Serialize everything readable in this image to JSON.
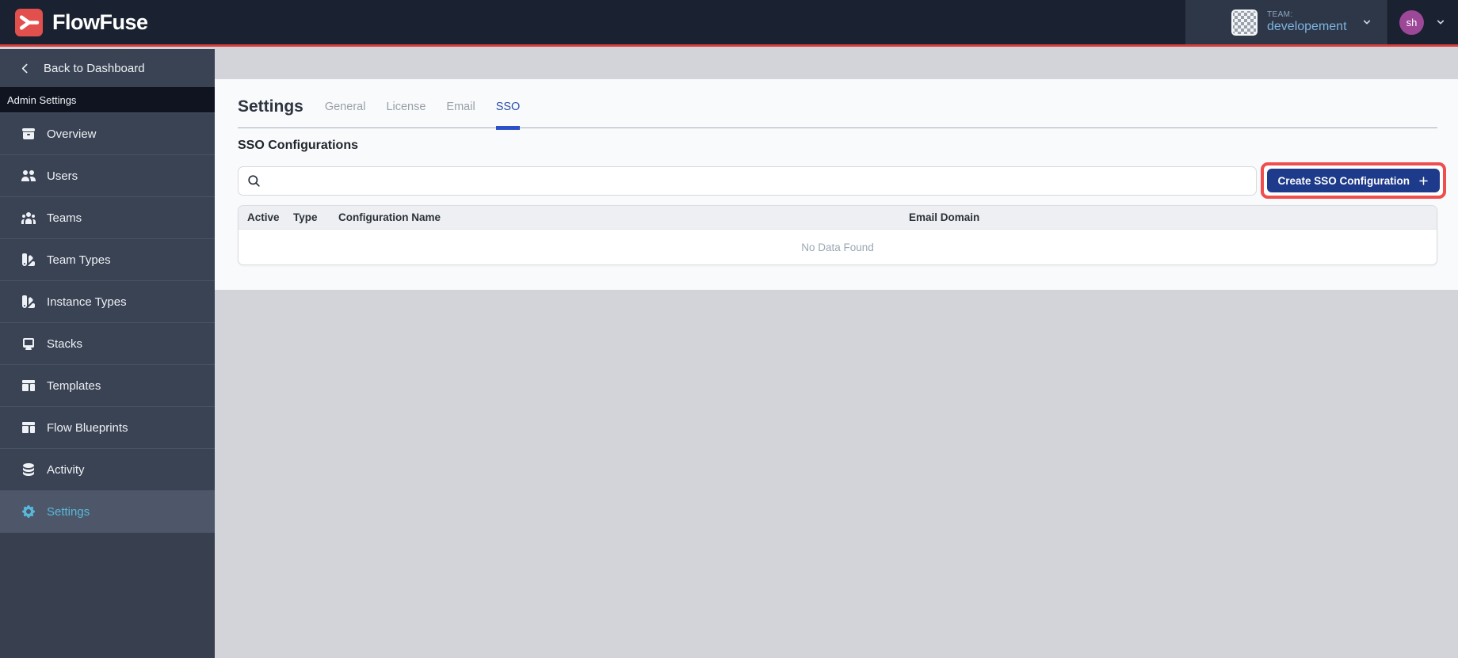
{
  "header": {
    "brand": "FlowFuse",
    "team_label": "TEAM:",
    "team_name": "developement",
    "avatar_initials": "sh"
  },
  "sidebar": {
    "back_label": "Back to Dashboard",
    "section_label": "Admin Settings",
    "items": [
      {
        "label": "Overview",
        "icon": "archive-icon",
        "active": false
      },
      {
        "label": "Users",
        "icon": "users-icon",
        "active": false
      },
      {
        "label": "Teams",
        "icon": "user-group-icon",
        "active": false
      },
      {
        "label": "Team Types",
        "icon": "color-swatch-icon",
        "active": false
      },
      {
        "label": "Instance Types",
        "icon": "color-swatch-icon",
        "active": false
      },
      {
        "label": "Stacks",
        "icon": "desktop-icon",
        "active": false
      },
      {
        "label": "Templates",
        "icon": "template-icon",
        "active": false
      },
      {
        "label": "Flow Blueprints",
        "icon": "template-icon",
        "active": false
      },
      {
        "label": "Activity",
        "icon": "database-icon",
        "active": false
      },
      {
        "label": "Settings",
        "icon": "cog-icon",
        "active": true
      }
    ]
  },
  "main": {
    "title": "Settings",
    "tabs": [
      {
        "label": "General",
        "active": false
      },
      {
        "label": "License",
        "active": false
      },
      {
        "label": "Email",
        "active": false
      },
      {
        "label": "SSO",
        "active": true
      }
    ],
    "section_title": "SSO Configurations",
    "search": {
      "value": "",
      "placeholder": ""
    },
    "create_button_label": "Create SSO Configuration",
    "table": {
      "columns": [
        "Active",
        "Type",
        "Configuration Name",
        "Email Domain"
      ],
      "rows": [],
      "empty_text": "No Data Found"
    }
  },
  "colors": {
    "brand_red": "#d63f3d",
    "logo_red": "#e2504e",
    "header_bg": "#1a2130",
    "team_panel_bg": "#2e3748",
    "sidebar_bg": "#3a4354",
    "sidebar_active_bg": "#4d5769",
    "sidebar_active_text": "#58b8da",
    "active_tab_blue": "#2b50c8",
    "button_navy": "#1e3a8a",
    "annotation_red": "#ef4e4e",
    "avatar_purple": "#9c4798",
    "panel_bg": "#f8fafb",
    "page_gray": "#d2d4da"
  }
}
